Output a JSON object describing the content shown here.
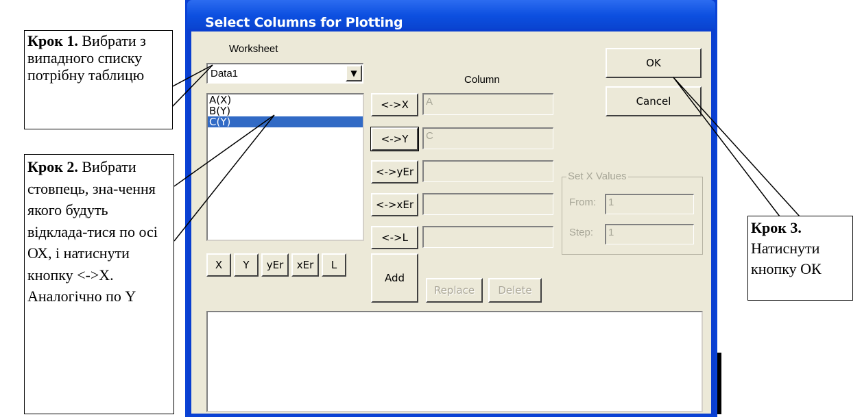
{
  "dialog": {
    "title": "Select Columns for Plotting",
    "worksheet_label": "Worksheet",
    "worksheet_value": "Data1",
    "column_label": "Column",
    "columns_list": [
      "A(X)",
      "B(Y)",
      "C(Y)"
    ],
    "selected_column": "C(Y)",
    "assign_buttons": [
      "<->X",
      "<->Y",
      "<->yEr",
      "<->xEr",
      "<->L"
    ],
    "assign_values": [
      "A",
      "C",
      "",
      "",
      ""
    ],
    "type_buttons": [
      "X",
      "Y",
      "yEr",
      "xEr",
      "L"
    ],
    "ok_label": "OK",
    "cancel_label": "Cancel",
    "add_label": "Add",
    "replace_label": "Replace",
    "delete_label": "Delete",
    "setx": {
      "title": "Set X Values",
      "from_label": "From:",
      "from_value": "1",
      "step_label": "Step:",
      "step_value": "1"
    }
  },
  "annotations": {
    "step1": {
      "bold": "Крок 1.",
      "text": " Вибрати з випадного списку потрібну таблицю"
    },
    "step2": {
      "bold": "Крок 2.",
      "text": " Вибрати стовпець, зна-чення якого будуть відклада-тися по осі ОХ, і натиснути кнопку <->X. Аналогічно по Y"
    },
    "step3": {
      "bold": "Крок 3.",
      "text": " Натиснути кнопку ОК"
    }
  }
}
